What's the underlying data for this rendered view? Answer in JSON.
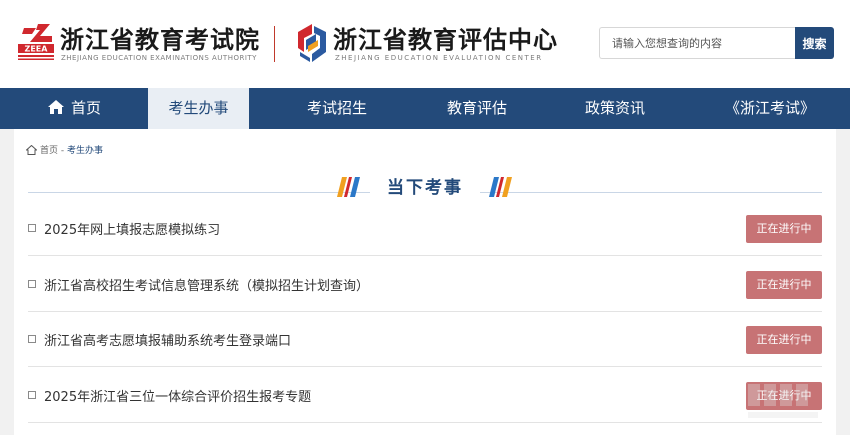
{
  "header": {
    "brand1": {
      "logo_text": "ZEEA",
      "title": "浙江省教育考试院",
      "subtitle": "ZHEJIANG EDUCATION EXAMINATIONS AUTHORITY"
    },
    "brand2": {
      "title": "浙江省教育评估中心",
      "subtitle": "ZHEJIANG EDUCATION EVALUATION CENTER"
    },
    "search": {
      "placeholder": "请输入您想查询的内容",
      "button_label": "搜索"
    }
  },
  "nav": {
    "items": [
      {
        "label": "首页",
        "icon": "home-icon"
      },
      {
        "label": "考生办事",
        "active": true
      },
      {
        "label": "考试招生"
      },
      {
        "label": "教育评估"
      },
      {
        "label": "政策资讯"
      },
      {
        "label": "《浙江考试》"
      }
    ]
  },
  "breadcrumb": {
    "home": "首页",
    "separator": "-",
    "current": "考生办事"
  },
  "section": {
    "title": "当下考事"
  },
  "items": [
    {
      "title": "2025年网上填报志愿模拟练习",
      "status": "正在进行中"
    },
    {
      "title": "浙江省高校招生考试信息管理系统（模拟招生计划查询）",
      "status": "正在进行中"
    },
    {
      "title": "浙江省高考志愿填报辅助系统考生登录端口",
      "status": "正在进行中"
    },
    {
      "title": "2025年浙江省三位一体综合评价招生报考专题",
      "status": "正在进行中"
    }
  ],
  "colors": {
    "primary": "#234a7a",
    "status_bg": "#c77375",
    "brand_red": "#c0392b"
  }
}
